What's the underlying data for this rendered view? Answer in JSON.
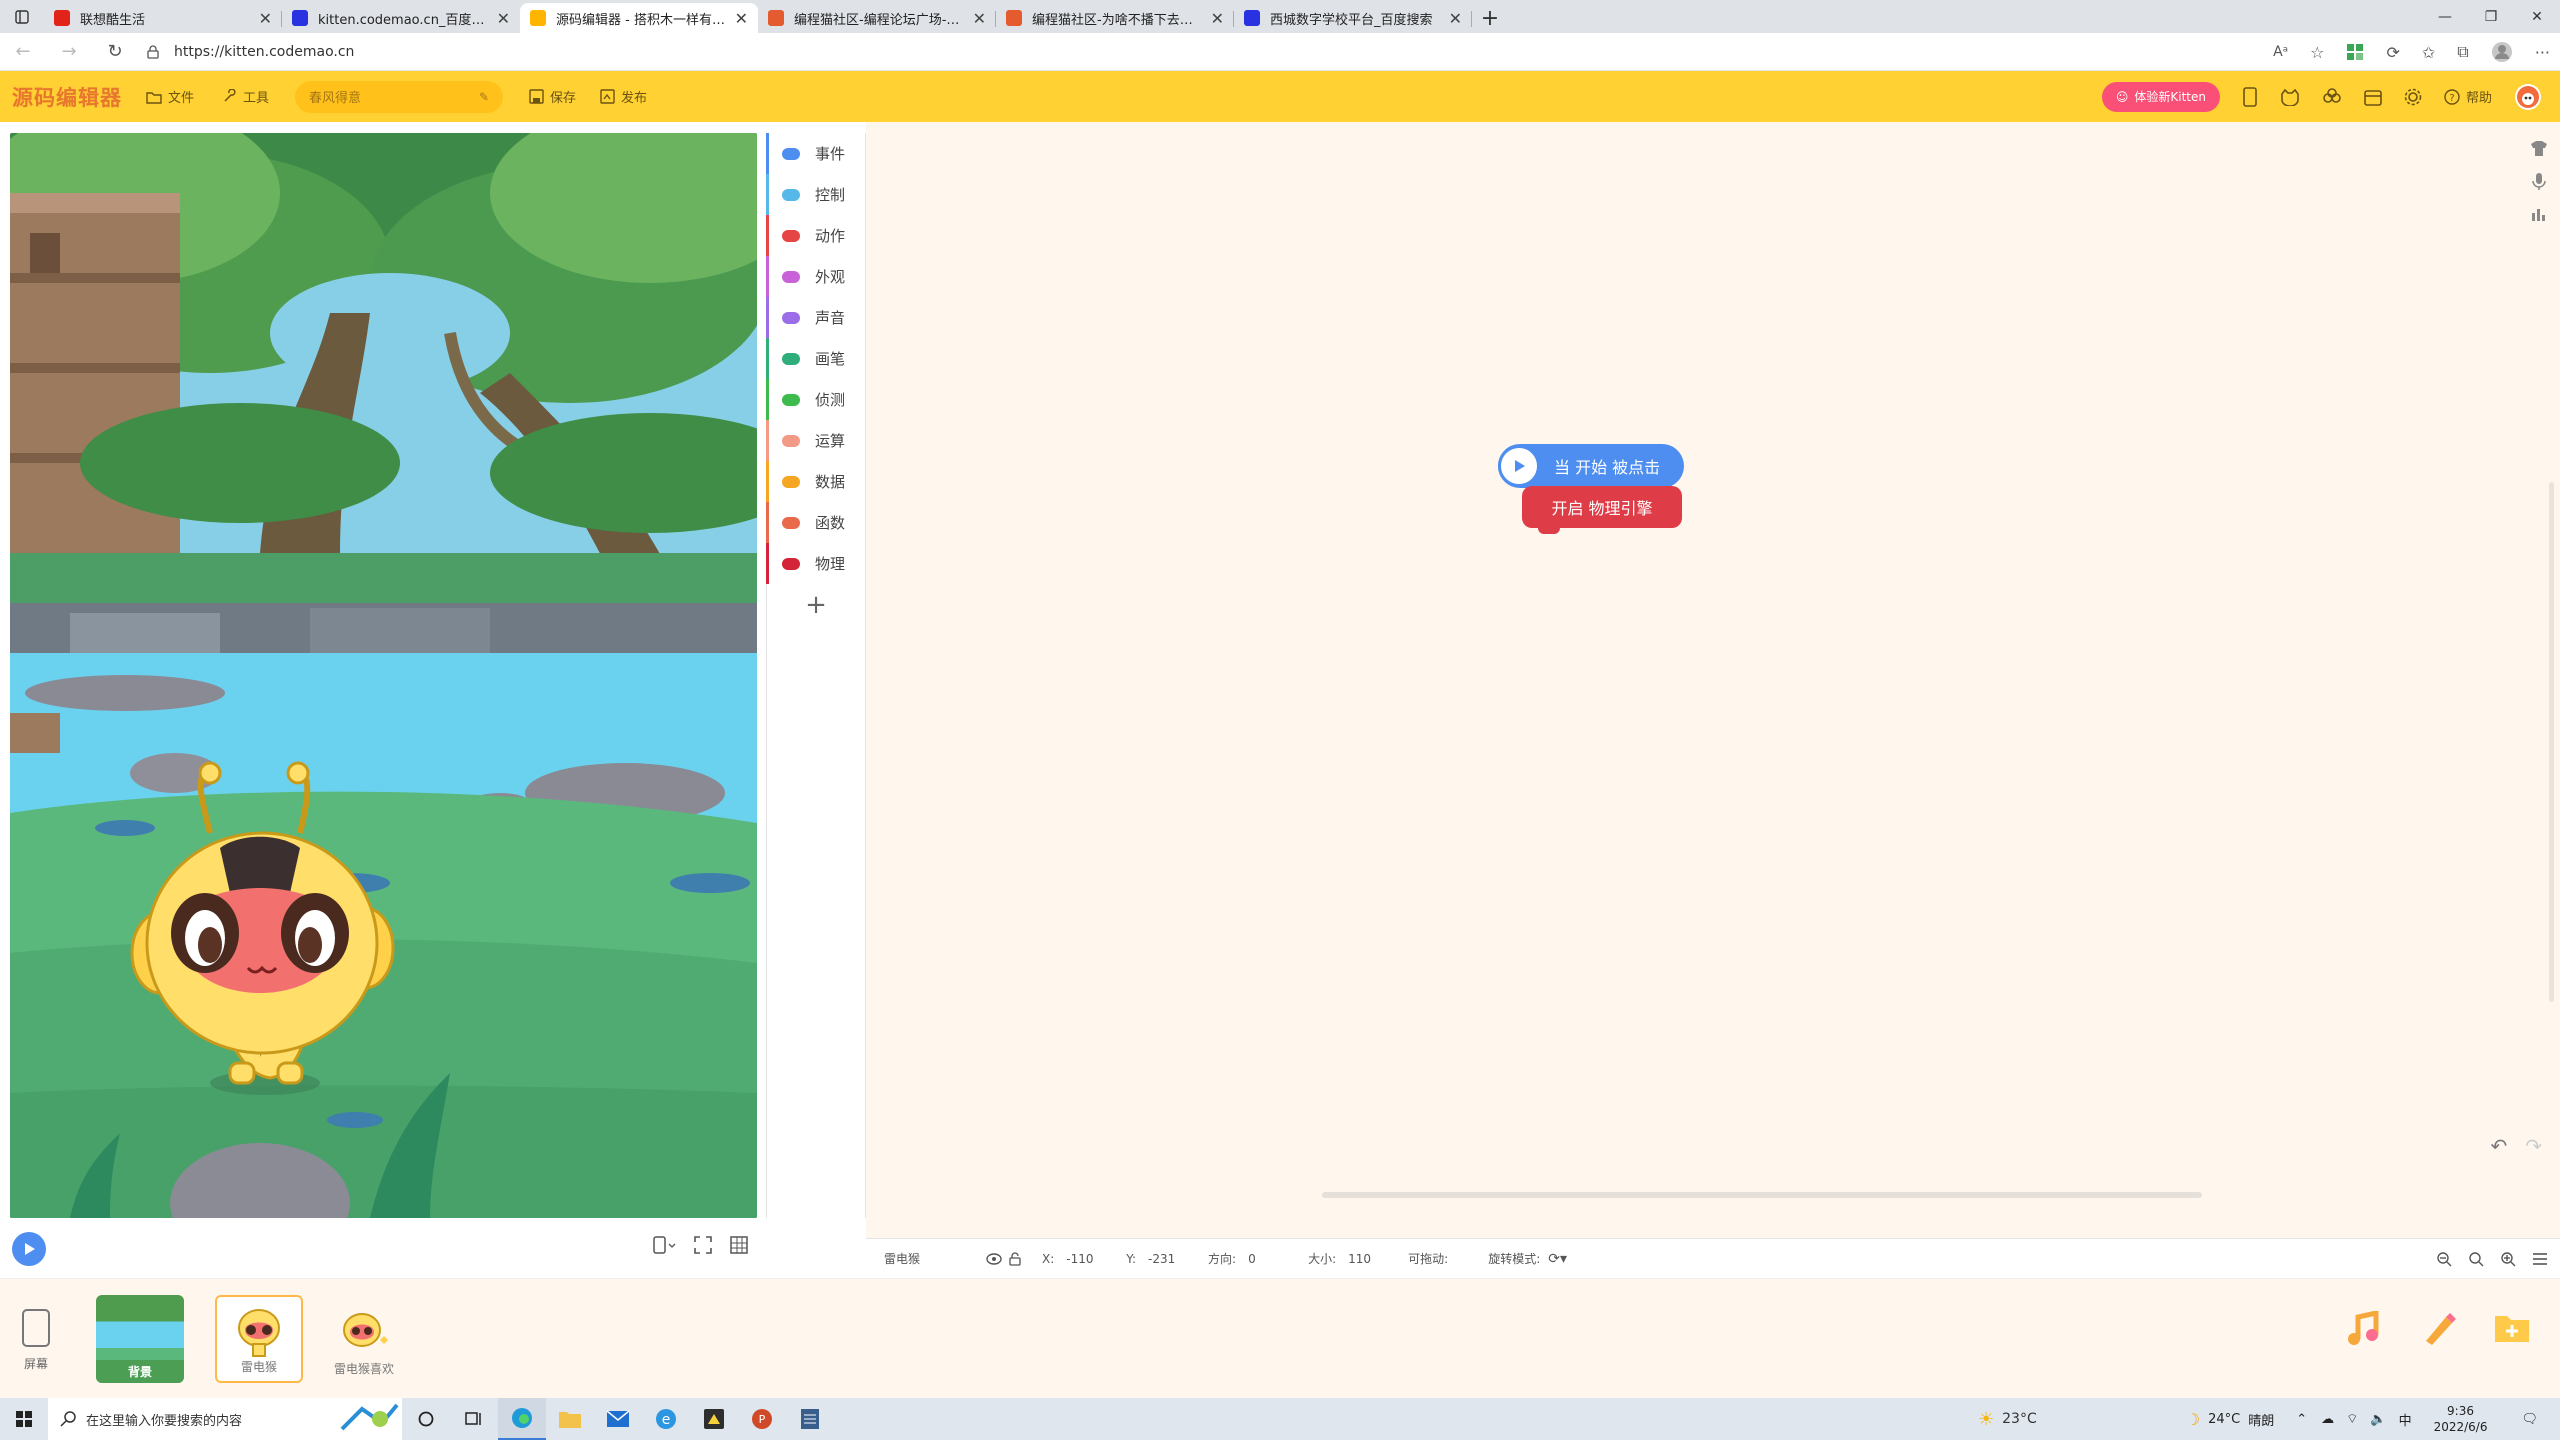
{
  "browser": {
    "tabs": [
      {
        "title": "联想酷生活",
        "color": "#e2231a"
      },
      {
        "title": "kitten.codemao.cn_百度搜索",
        "color": "#2932e1"
      },
      {
        "title": "源码编辑器 - 搭积木一样有趣的编",
        "color": "#ffb400"
      },
      {
        "title": "编程猫社区-编程论坛广场-编程猫",
        "color": "#e35b2f"
      },
      {
        "title": "编程猫社区-为啥不播下去？-编程",
        "color": "#e35b2f"
      },
      {
        "title": "西城数字学校平台_百度搜索",
        "color": "#2932e1"
      }
    ],
    "url": "https://kitten.codemao.cn"
  },
  "toolbar": {
    "logo": "源码编辑器",
    "file": "文件",
    "tools": "工具",
    "project_title": "春风得意",
    "save": "保存",
    "publish": "发布",
    "try_kitten": "体验新Kitten",
    "help": "帮助",
    "accent": "#ffd133"
  },
  "categories": [
    {
      "label": "事件",
      "color": "#4d8ef0",
      "icon": "toggle-icon"
    },
    {
      "label": "控制",
      "color": "#55b8e8",
      "icon": "gamepad-icon"
    },
    {
      "label": "动作",
      "color": "#e64545",
      "icon": "motion-icon"
    },
    {
      "label": "外观",
      "color": "#c962d8",
      "icon": "shirt-icon"
    },
    {
      "label": "声音",
      "color": "#9b6ee8",
      "icon": "microphone-icon"
    },
    {
      "label": "画笔",
      "color": "#2fae7b",
      "icon": "pen-icon"
    },
    {
      "label": "侦测",
      "color": "#3dbb4c",
      "icon": "sensor-icon"
    },
    {
      "label": "运算",
      "color": "#f29a86",
      "icon": "grid-icon"
    },
    {
      "label": "数据",
      "color": "#f5a623",
      "icon": "bar-chart-icon"
    },
    {
      "label": "函数",
      "color": "#e96a4a",
      "icon": "function-icon"
    },
    {
      "label": "物理",
      "color": "#d4243a",
      "icon": "magnet-icon"
    }
  ],
  "blocks": {
    "event": "当 开始 被点击",
    "physics": "开启 物理引擎"
  },
  "props": {
    "name": "雷电猴",
    "x_label": "X:",
    "x": "-110",
    "y_label": "Y:",
    "y": "-231",
    "dir_label": "方向:",
    "dir": "0",
    "size_label": "大小:",
    "size": "110",
    "drag_label": "可拖动:",
    "rot_label": "旋转模式:"
  },
  "assets": {
    "screen": "屏幕",
    "background": "背景",
    "sprite1": "雷电猴",
    "sprite2": "雷电猴喜欢"
  },
  "taskbar": {
    "search": "在这里输入你要搜索的内容",
    "weather1": "23°C",
    "weather2": "24°C",
    "weather2_desc": "晴朗",
    "ime": "中",
    "time": "9:36",
    "date": "2022/6/6"
  }
}
